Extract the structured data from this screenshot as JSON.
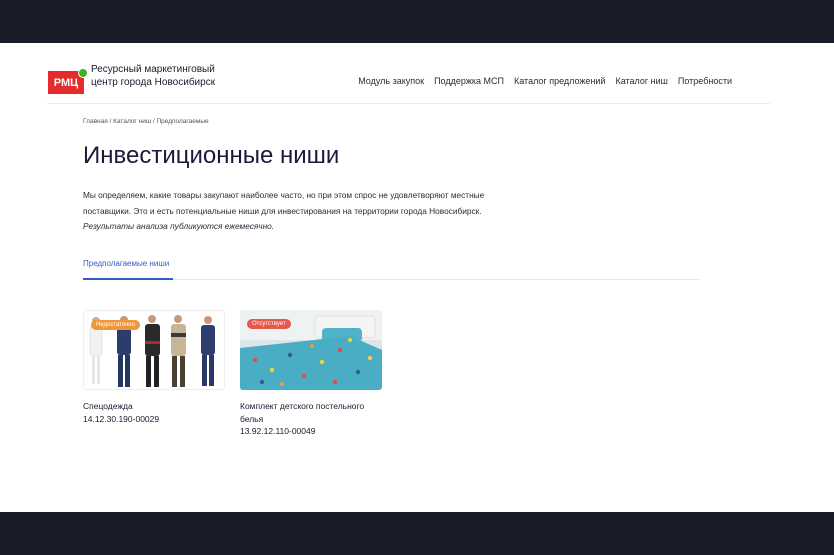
{
  "header": {
    "logo_text": "РМЦ",
    "org_name": "Ресурсный маркетинговый центр города Новосибирск",
    "nav": [
      "Модуль закупок",
      "Поддержка МСП",
      "Каталог предложений",
      "Каталог ниш",
      "Потребности"
    ]
  },
  "breadcrumb": {
    "home": "Главная",
    "sep1": " / ",
    "catalog": "Каталог ниш",
    "sep2": " / ",
    "current": "Предполагаемые"
  },
  "page_title": "Инвестиционные ниши",
  "description": {
    "text": "Мы определяем, какие товары закупают наиболее часто, но при этом спрос не удовлетворяют местные поставщики. Это и есть потенциальные ниши для инвестирования на территории города Новосибирск.",
    "note": "Результаты анализа публикуются ежемесячно."
  },
  "tabs": {
    "active": "Предполагаемые ниши"
  },
  "cards": [
    {
      "badge": "Недостаточно",
      "badge_color": "#f0963a",
      "name": "Спецодежда",
      "code": "14.12.30.190-00029"
    },
    {
      "badge": "Отсутствует",
      "badge_color": "#e8574a",
      "name": "Комплект детского постельного белья",
      "code": "13.92.12.110-00049"
    }
  ],
  "colors": {
    "accent": "#2f5ec4",
    "brand": "#e52b2b",
    "brand_dot": "#43b02a",
    "frame": "#1a1d29"
  }
}
